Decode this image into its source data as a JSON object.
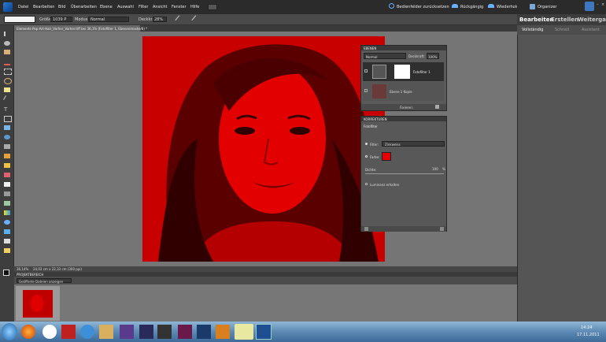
{
  "menu": {
    "items": [
      "Datei",
      "Bearbeiten",
      "Bild",
      "Überarbeiten",
      "Ebene",
      "Auswahl",
      "Filter",
      "Ansicht",
      "Fenster",
      "Hilfe"
    ],
    "reset_panels": "Bedienfelder zurücksetzen",
    "undo": "Rückgängig",
    "redo": "Wiederholen",
    "organizer": "Organizer"
  },
  "options": {
    "size_label": "Größe:",
    "size_value": "1039 P",
    "mode_label": "Modus:",
    "mode_value": "Normal",
    "opacity_label": "Deckkr.:",
    "opacity_value": "28%"
  },
  "mode_tabs": {
    "edit": "Bearbeiten",
    "create": "Erstellen",
    "share": "Weitergabe"
  },
  "edit_modes": {
    "full": "Vollständig",
    "quick": "Schnell",
    "guided": "Assistent"
  },
  "document": {
    "tab_title": "Elements-Pop-Art-Hair_Vorher_Vorher.tiff bei 36,1% (Fotofilter 1, Ebenenmaske/8) *",
    "zoom": "36,14%",
    "dimensions": "24,03 cm x 22,33 cm (300 ppi)"
  },
  "layers_panel": {
    "title": "EBENEN",
    "blend_mode": "Normal",
    "opacity_label": "Deckkraft:",
    "opacity_value": "100%",
    "fill_label": "Fixieren:",
    "layers": [
      {
        "name": "Fotofilter 1"
      },
      {
        "name": "Ebene 1 Kopie"
      }
    ]
  },
  "adjust_panel": {
    "title": "KORREKTUREN",
    "subtitle": "Fotofilter",
    "filter_label": "Filter:",
    "filter_value": "Zinkweiss",
    "color_label": "Farbe:",
    "density_label": "Dichte:",
    "density_value": "100",
    "density_unit": "%",
    "preserve_label": "Luminanz erhalten",
    "color": "#e60000"
  },
  "project_bin": {
    "title": "PROJEKTBEREICH",
    "dropdown": "Geöffnete Dateien anzeigen"
  },
  "taskbar": {
    "time": "14:24",
    "date": "17.11.2011"
  },
  "colors": {
    "image_red": "#c80000",
    "panel_dark": "#3a3a3a",
    "menubar": "#2b2b2b"
  }
}
